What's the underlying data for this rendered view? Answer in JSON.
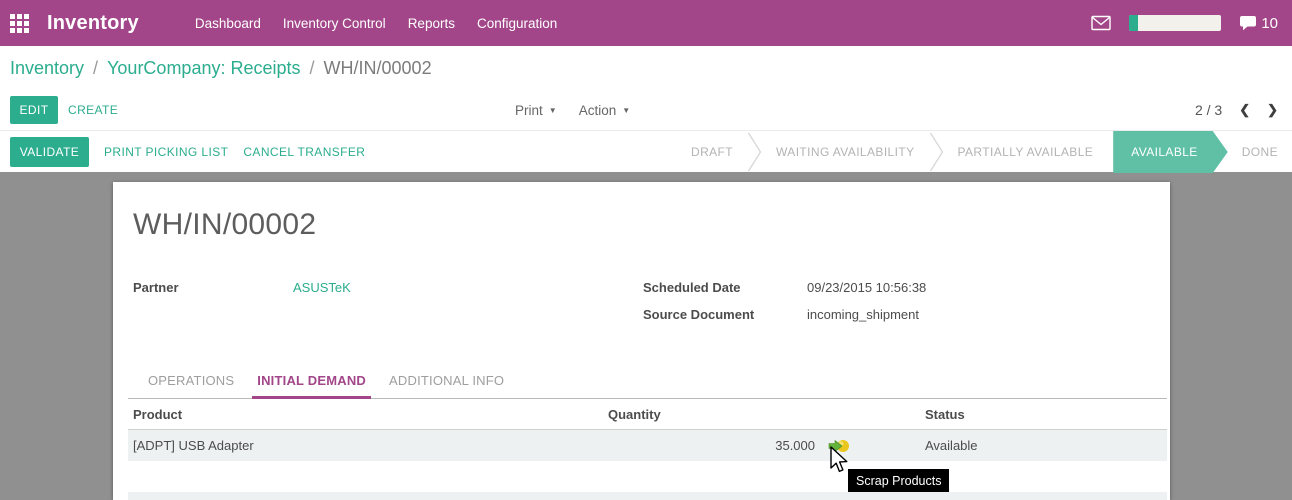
{
  "topbar": {
    "app_title": "Inventory",
    "menu": [
      "Dashboard",
      "Inventory Control",
      "Reports",
      "Configuration"
    ],
    "messages_count": "10",
    "progress_percent": 9
  },
  "breadcrumb": {
    "items": [
      "Inventory",
      "YourCompany: Receipts",
      "WH/IN/00002"
    ],
    "separator": "/"
  },
  "actions": {
    "edit": "EDIT",
    "create": "CREATE",
    "print": "Print",
    "action": "Action",
    "pager": "2 / 3"
  },
  "statusbar": {
    "buttons": [
      "VALIDATE",
      "PRINT PICKING LIST",
      "CANCEL TRANSFER"
    ],
    "stages": [
      "DRAFT",
      "WAITING AVAILABILITY",
      "PARTIALLY AVAILABLE",
      "AVAILABLE",
      "DONE"
    ],
    "active_stage": "AVAILABLE"
  },
  "form": {
    "title": "WH/IN/00002",
    "fields": [
      {
        "label": "Partner",
        "value": "ASUSTeK"
      },
      {
        "label": "Scheduled Date",
        "value": "09/23/2015 10:56:38"
      },
      {
        "label": "Source Document",
        "value": "incoming_shipment"
      }
    ],
    "tabs": [
      {
        "label": "OPERATIONS",
        "active": false
      },
      {
        "label": "INITIAL DEMAND",
        "active": true
      },
      {
        "label": "ADDITIONAL INFO",
        "active": false
      }
    ],
    "table": {
      "columns": [
        "Product",
        "Quantity",
        "Status"
      ],
      "rows": [
        {
          "product": "[ADPT] USB Adapter",
          "quantity": "35.000",
          "status": "Available"
        }
      ]
    }
  },
  "tooltip": {
    "text": "Scrap Products"
  },
  "icons": {
    "pager_prev": "❮",
    "pager_next": "❯",
    "caret": "▼"
  },
  "colors": {
    "topbar_purple": "#a24689",
    "teal": "#2bad8e",
    "stage_active_teal": "#5fc0a6",
    "page_bg": "#909090",
    "row_bg": "#eef1f1",
    "active_tab": "#a24689",
    "tooltip_bg": "#000000"
  }
}
